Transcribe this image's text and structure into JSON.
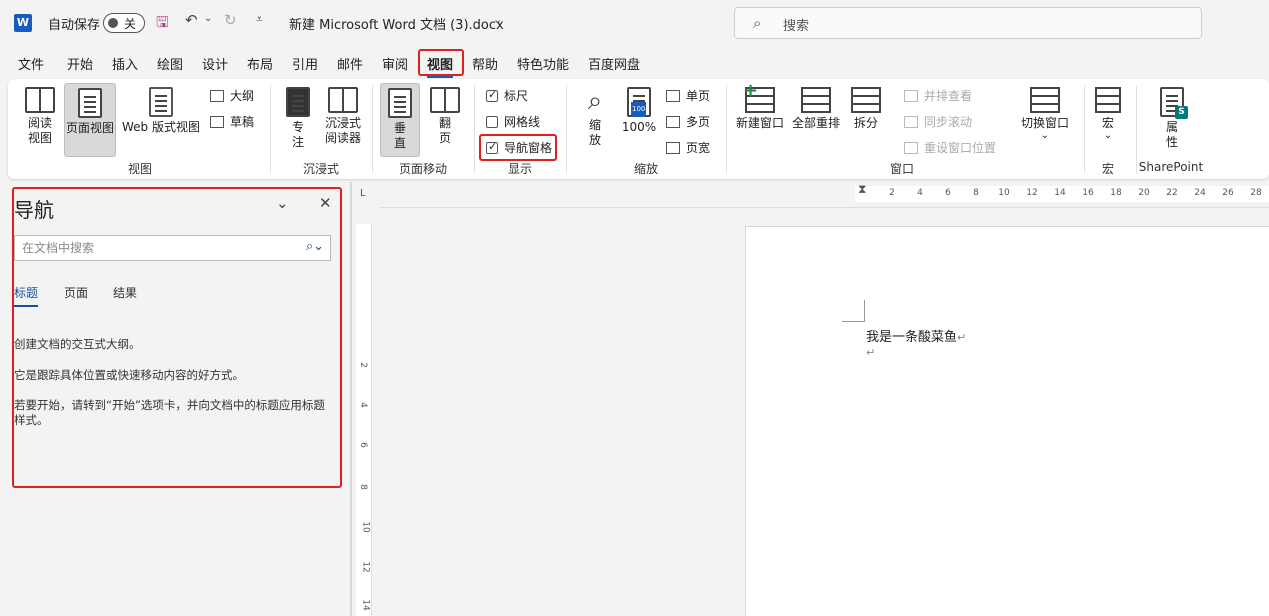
{
  "titlebar": {
    "logo": "W",
    "autosave_label": "自动保存",
    "autosave_state": "关",
    "doc_title": "新建 Microsoft Word 文档 (3).docx",
    "search_placeholder": "搜索"
  },
  "menu": {
    "items": [
      "文件",
      "开始",
      "插入",
      "绘图",
      "设计",
      "布局",
      "引用",
      "邮件",
      "审阅",
      "视图",
      "帮助",
      "特色功能",
      "百度网盘"
    ],
    "active": "视图"
  },
  "ribbon": {
    "view_group": {
      "label": "视图",
      "read_mode": "阅读\n视图",
      "print_layout": "页面视图",
      "web_layout": "Web 版式视图",
      "outline": "大纲",
      "draft": "草稿"
    },
    "immersive_group": {
      "label": "沉浸式",
      "focus": "专\n注",
      "immersive_reader": "沉浸式\n阅读器"
    },
    "page_move_group": {
      "label": "页面移动",
      "vertical": "垂\n直",
      "side_to_side": "翻\n页"
    },
    "show_group": {
      "label": "显示",
      "ruler": "标尺",
      "ruler_checked": true,
      "gridlines": "网格线",
      "gridlines_checked": false,
      "nav_pane": "导航窗格",
      "nav_pane_checked": true
    },
    "zoom_group": {
      "label": "缩放",
      "zoom": "缩\n放",
      "zoom_100": "100%",
      "zoom_100_icon": "100",
      "one_page": "单页",
      "multiple_pages": "多页",
      "page_width": "页宽"
    },
    "window_group": {
      "label": "窗口",
      "new_window": "新建窗口",
      "arrange_all": "全部重排",
      "split": "拆分",
      "view_side_by_side": "并排查看",
      "sync_scroll": "同步滚动",
      "reset_window": "重设窗口位置",
      "switch_windows": "切换窗口"
    },
    "macros_group": {
      "label": "宏",
      "macros": "宏"
    },
    "sharepoint_group": {
      "label": "SharePoint",
      "properties": "属\n性",
      "sp_badge": "S"
    }
  },
  "nav_pane": {
    "title": "导航",
    "search_placeholder": "在文档中搜索",
    "tabs": [
      "标题",
      "页面",
      "结果"
    ],
    "active_tab": "标题",
    "text1": "创建文档的交互式大纲。",
    "text2": "它是跟踪具体位置或快速移动内容的好方式。",
    "text3": "若要开始，请转到“开始”选项卡，并向文档中的标题应用标题样式。"
  },
  "ruler": {
    "h_ticks": [
      "2",
      "4",
      "6",
      "8",
      "10",
      "12",
      "14",
      "16",
      "18",
      "20",
      "22",
      "24",
      "26",
      "28"
    ],
    "v_ticks": [
      "2",
      "4",
      "6",
      "8",
      "10",
      "12",
      "14"
    ],
    "corner": "L"
  },
  "document": {
    "line1": "我是一条酸菜鱼",
    "para_mark": "↵"
  },
  "colors": {
    "accent": "#185abd",
    "highlight_box": "#e02020"
  }
}
